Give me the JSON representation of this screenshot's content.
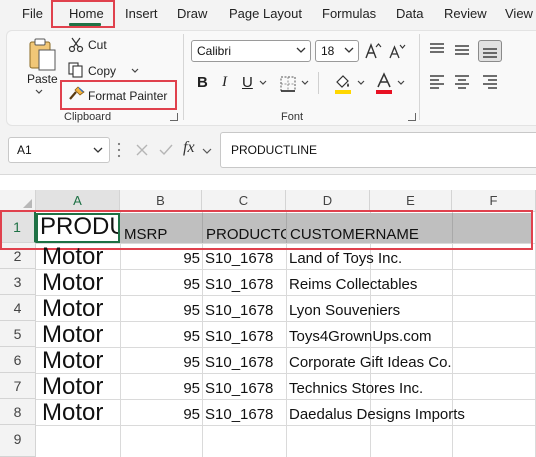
{
  "menu": {
    "tabs": [
      "File",
      "Home",
      "Insert",
      "Draw",
      "Page Layout",
      "Formulas",
      "Data",
      "Review",
      "View"
    ]
  },
  "clipboard": {
    "paste": "Paste",
    "cut": "Cut",
    "copy": "Copy",
    "format_painter": "Format Painter",
    "group_label": "Clipboard"
  },
  "font": {
    "name": "Calibri",
    "size": "18",
    "group_label": "Font"
  },
  "formula_bar": {
    "name_box": "A1",
    "fx": "fx",
    "value": "PRODUCTLINE"
  },
  "grid": {
    "columns": [
      "A",
      "B",
      "C",
      "D",
      "E",
      "F"
    ],
    "rows": [
      "1",
      "2",
      "3",
      "4",
      "5",
      "6",
      "7",
      "8",
      "9"
    ],
    "header_row": {
      "a": "PRODU",
      "b": "MSRP",
      "c": "PRODUCTC",
      "d": "CUSTOMERNAME"
    },
    "data_rows": [
      {
        "a": "Motor",
        "b": "95",
        "c": "S10_1678",
        "d": "Land of Toys Inc."
      },
      {
        "a": "Motor",
        "b": "95",
        "c": "S10_1678",
        "d": "Reims Collectables"
      },
      {
        "a": "Motor",
        "b": "95",
        "c": "S10_1678",
        "d": "Lyon Souveniers"
      },
      {
        "a": "Motor",
        "b": "95",
        "c": "S10_1678",
        "d": "Toys4GrownUps.com"
      },
      {
        "a": "Motor",
        "b": "95",
        "c": "S10_1678",
        "d": "Corporate Gift Ideas Co."
      },
      {
        "a": "Motor",
        "b": "95",
        "c": "S10_1678",
        "d": "Technics Stores Inc."
      },
      {
        "a": "Motor",
        "b": "95",
        "c": "S10_1678",
        "d": "Daedalus Designs Imports"
      }
    ]
  },
  "colors": {
    "accent": "#1e7145",
    "highlight_box": "#e0414d",
    "header_fill": "#bfbfbf",
    "font_color_bar": "#e81123",
    "fill_color_bar": "#ffd700"
  },
  "icons": [
    "paste-icon",
    "cut-icon",
    "copy-icon",
    "format-painter-icon",
    "increase-font-icon",
    "decrease-font-icon",
    "bold-icon",
    "italic-icon",
    "underline-icon",
    "borders-icon",
    "fill-color-icon",
    "font-color-icon",
    "align-top-icon",
    "align-middle-icon",
    "align-bottom-icon",
    "align-left-icon",
    "align-center-icon",
    "align-right-icon",
    "cancel-icon",
    "enter-icon",
    "function-icon"
  ]
}
